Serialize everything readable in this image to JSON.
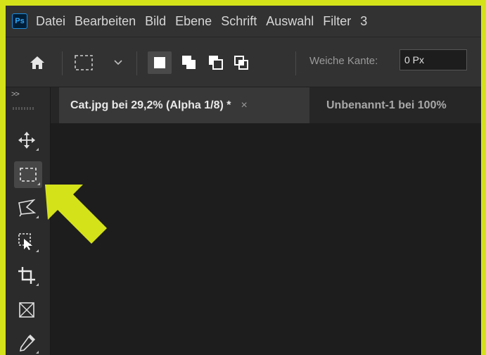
{
  "app": {
    "logo_text": "Ps"
  },
  "menu": {
    "items": [
      "Datei",
      "Bearbeiten",
      "Bild",
      "Ebene",
      "Schrift",
      "Auswahl",
      "Filter",
      "3"
    ]
  },
  "options": {
    "feather_label": "Weiche Kante:",
    "feather_value": "0 Px"
  },
  "tabs": {
    "active_title": "Cat.jpg bei 29,2% (Alpha 1/8) *",
    "active_close": "×",
    "inactive_title": "Unbenannt-1 bei 100%"
  },
  "toolbar": {
    "collapse": ">>",
    "tools": [
      "move-tool",
      "rectangular-marquee-tool",
      "polygonal-lasso-tool",
      "object-selection-tool",
      "crop-tool",
      "frame-tool",
      "eyedropper-tool"
    ],
    "active_tool": "rectangular-marquee-tool"
  },
  "colors": {
    "highlight": "#d4e21a",
    "panel": "#323232",
    "canvas": "#1d1d1d",
    "ps_blue": "#31a8ff"
  }
}
